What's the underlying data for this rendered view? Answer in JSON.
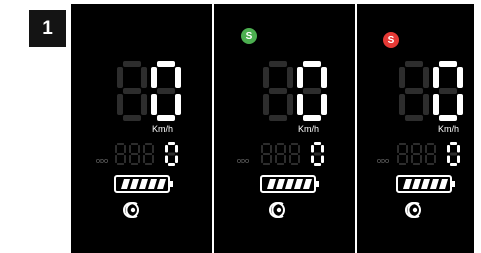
{
  "step_number": "1",
  "panels": [
    {
      "indicator": null,
      "speed_value": "0",
      "speed_unit": "Km/h",
      "odometer_label": "ODO",
      "odometer_value": "0",
      "battery_bars": 5
    },
    {
      "indicator": {
        "label": "S",
        "color": "#4caf50"
      },
      "speed_value": "0",
      "speed_unit": "Km/h",
      "odometer_label": "ODO",
      "odometer_value": "0",
      "battery_bars": 5
    },
    {
      "indicator": {
        "label": "S",
        "color": "#e53935"
      },
      "speed_value": "0",
      "speed_unit": "Km/h",
      "odometer_label": "ODO",
      "odometer_value": "0",
      "battery_bars": 5
    }
  ],
  "colors": {
    "lit": "#ffffff",
    "dim": "#2d2d2d"
  },
  "icons": [
    "assist-mode-icon",
    "battery-icon"
  ]
}
